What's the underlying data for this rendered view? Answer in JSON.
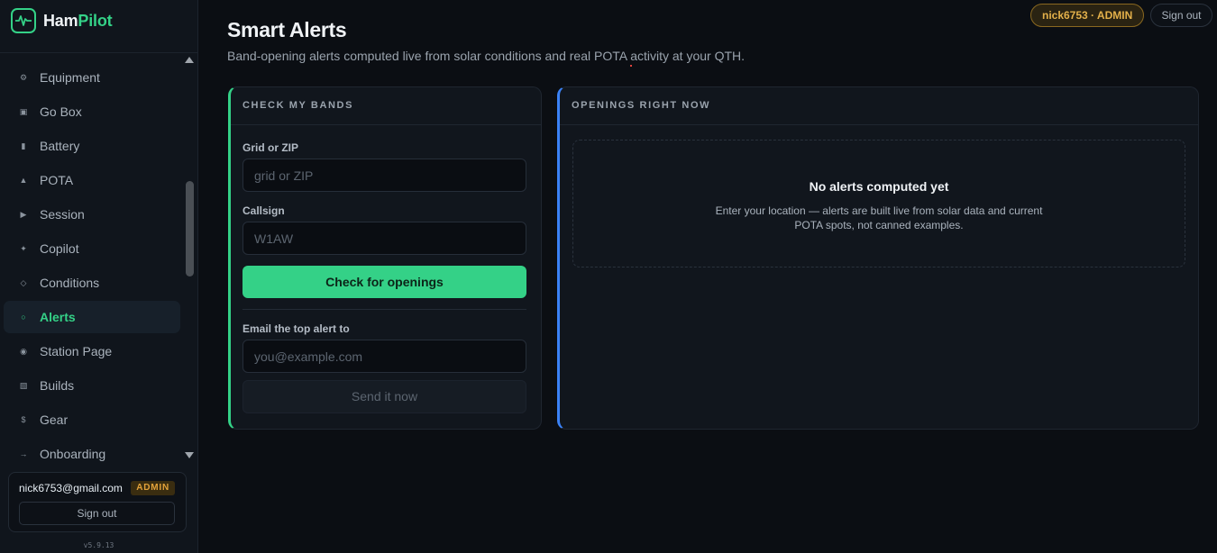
{
  "brand": {
    "name_part1": "Ham",
    "name_part2": "Pilot",
    "icon": "pulse-icon",
    "accent": "#34d187"
  },
  "sidebar": {
    "items": [
      {
        "label": "Equipment",
        "icon": "gear-icon",
        "glyph": "⚙"
      },
      {
        "label": "Go Box",
        "icon": "box-icon",
        "glyph": "▣"
      },
      {
        "label": "Battery",
        "icon": "battery-icon",
        "glyph": "▮"
      },
      {
        "label": "POTA",
        "icon": "triangle-icon",
        "glyph": "▲"
      },
      {
        "label": "Session",
        "icon": "play-icon",
        "glyph": "▶"
      },
      {
        "label": "Copilot",
        "icon": "sparkle-icon",
        "glyph": "✦"
      },
      {
        "label": "Conditions",
        "icon": "diamond-icon",
        "glyph": "◇"
      },
      {
        "label": "Alerts",
        "icon": "circle-icon",
        "glyph": "○"
      },
      {
        "label": "Station Page",
        "icon": "station-icon",
        "glyph": "◉"
      },
      {
        "label": "Builds",
        "icon": "builds-icon",
        "glyph": "▧"
      },
      {
        "label": "Gear",
        "icon": "dollar-icon",
        "glyph": "$"
      },
      {
        "label": "Onboarding",
        "icon": "arrow-right-icon",
        "glyph": "→"
      }
    ],
    "active_label": "Alerts"
  },
  "user": {
    "email": "nick6753@gmail.com",
    "role": "ADMIN",
    "signout": "Sign out"
  },
  "version": "v5.9.13",
  "topbar": {
    "user_badge": "nick6753 · ADMIN",
    "signout": "Sign out"
  },
  "page": {
    "title": "Smart Alerts",
    "subtitle": "Band-opening alerts computed live from solar conditions and real POTA activity at your QTH."
  },
  "check_panel": {
    "header": "CHECK MY BANDS",
    "grid_label": "Grid or ZIP",
    "grid_placeholder": "grid or ZIP",
    "callsign_label": "Callsign",
    "callsign_placeholder": "W1AW",
    "check_button": "Check for openings",
    "email_label": "Email the top alert to",
    "email_placeholder": "you@example.com",
    "send_button": "Send it now"
  },
  "openings_panel": {
    "header": "OPENINGS RIGHT NOW",
    "empty_title": "No alerts computed yet",
    "empty_text": "Enter your location — alerts are built live from solar data and current POTA spots, not canned examples."
  },
  "colors": {
    "green": "#34d187",
    "blue": "#3b82f6",
    "admin": "#e3a23a"
  }
}
